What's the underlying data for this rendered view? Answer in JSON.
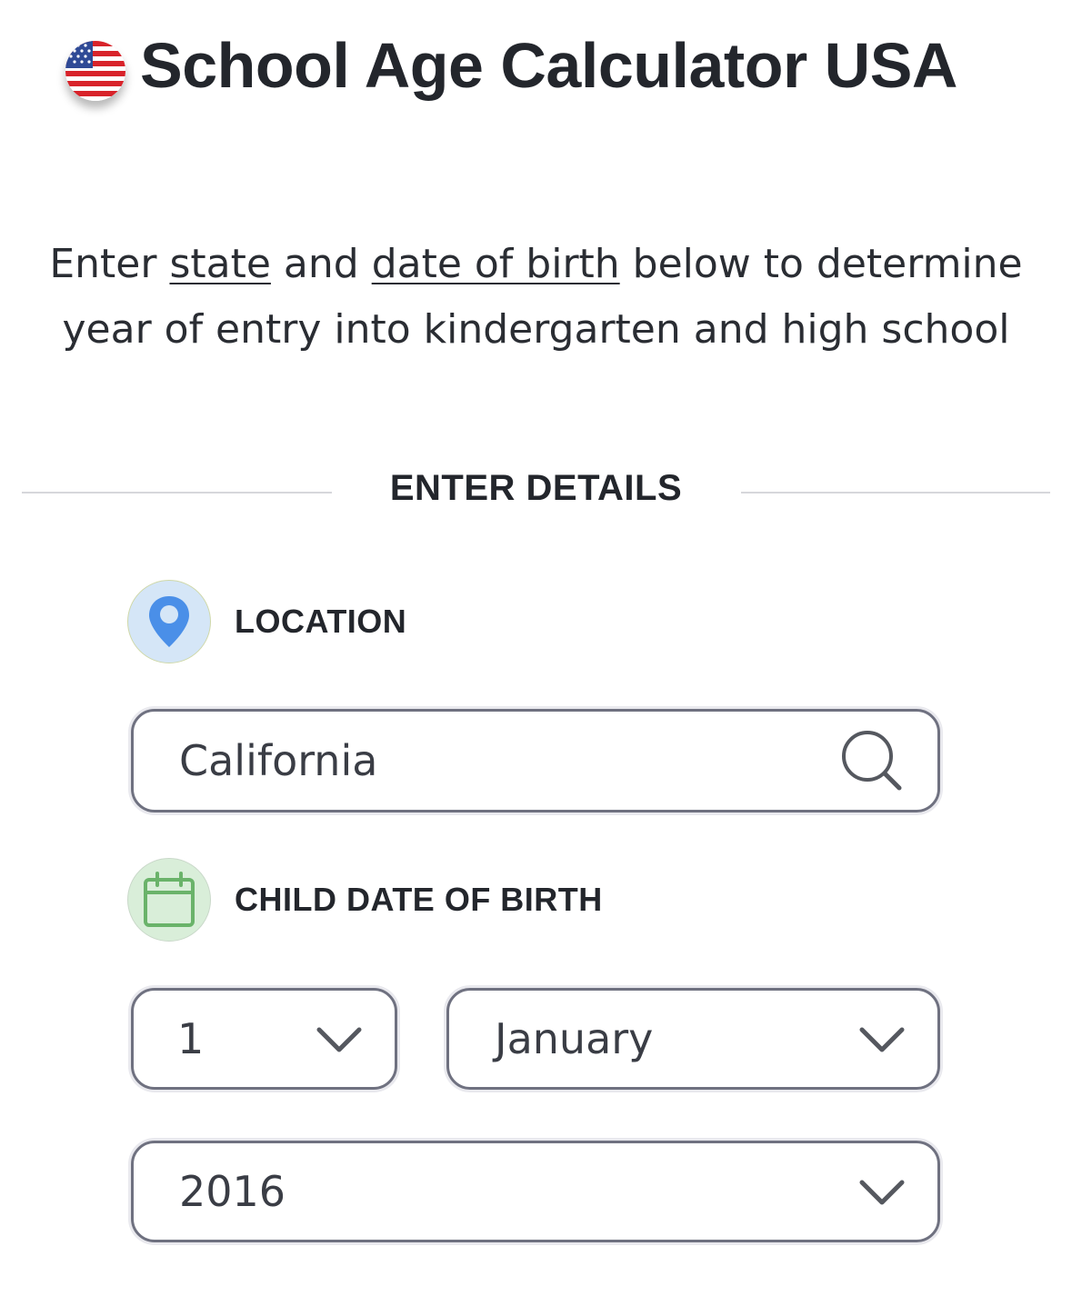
{
  "header": {
    "title": "School Age Calculator USA",
    "flag_icon": "us-flag-icon"
  },
  "intro": {
    "prefix": "Enter ",
    "link_state": "state",
    "middle": " and ",
    "link_dob": "date of birth",
    "suffix": " below to determine year of entry into kindergarten and high school"
  },
  "section_divider": {
    "label": "ENTER DETAILS"
  },
  "location": {
    "label": "LOCATION",
    "icon": "map-pin-icon",
    "value": "California",
    "search_icon": "search-icon"
  },
  "dob": {
    "label": "CHILD DATE OF BIRTH",
    "icon": "calendar-icon",
    "day": "1",
    "month": "January",
    "year": "2016",
    "chevron_icon": "chevron-down-icon"
  },
  "colors": {
    "text": "#23262c",
    "field_border": "#6f7180",
    "pin_blue": "#4a8fe8",
    "calendar_green": "#6ab36a",
    "divider": "#d6d7db"
  }
}
